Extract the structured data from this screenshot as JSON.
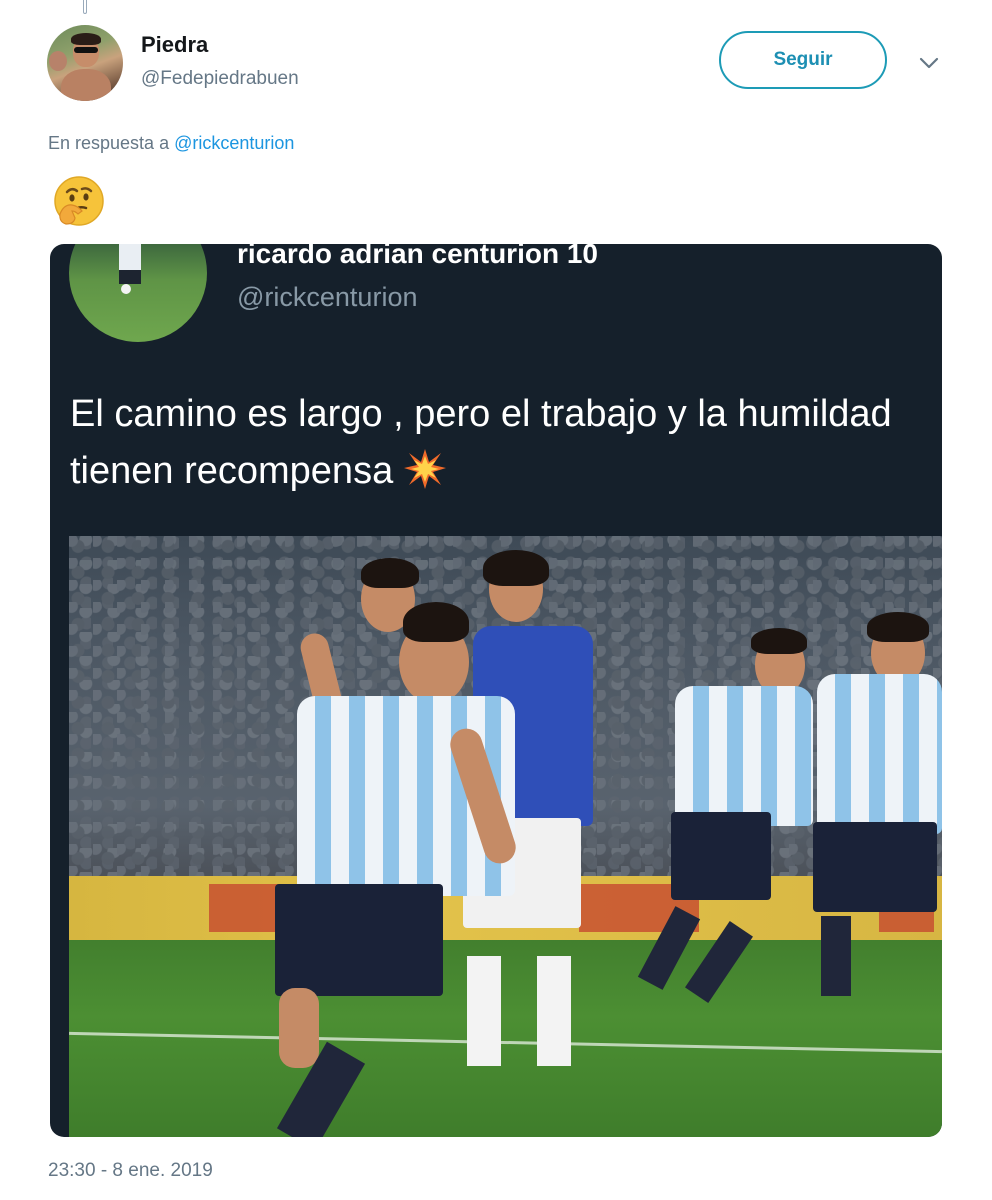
{
  "tweet": {
    "author_name": "Piedra",
    "author_handle": "@Fedepiedrabuen",
    "follow_label": "Seguir",
    "menu_icon": "chevron-down-icon",
    "reply_prefix": "En respuesta a",
    "reply_mention": "@rickcenturion",
    "body_emoji": "thinking-face-emoji",
    "timestamp": "23:30 - 8 ene. 2019"
  },
  "embedded": {
    "name": "ricardo adrian centurion 10",
    "handle": "@rickcenturion",
    "text": "El camino es largo , pero el trabajo y la humildad tienen recompensa",
    "trailing_emoji": "collision-emoji",
    "background": "#15202b"
  },
  "colors": {
    "accent": "#1b95e0",
    "follow_border": "#1d9bb6",
    "secondary_text": "#657786"
  }
}
